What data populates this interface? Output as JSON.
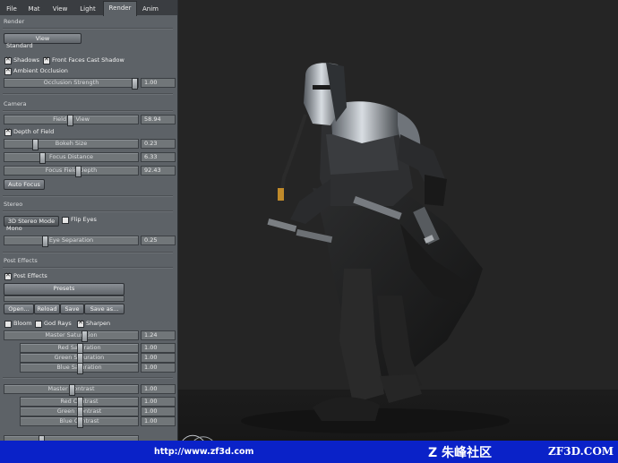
{
  "tabs": [
    "File",
    "Mat",
    "View",
    "Light",
    "Render",
    "Anim"
  ],
  "render": {
    "section": "Render",
    "view_button": "View",
    "view_value": "Standard",
    "shadows": {
      "label": "Shadows",
      "checked": true
    },
    "front_faces": {
      "label": "Front Faces Cast Shadow",
      "checked": true
    },
    "ambient_occlusion": {
      "label": "Ambient Occlusion",
      "checked": true
    },
    "occlusion_strength": {
      "label": "Occlusion Strength",
      "value": "1.00",
      "level": 0.97
    }
  },
  "camera": {
    "section": "Camera",
    "field_of_view": {
      "label": "Field of View",
      "value": "58.94",
      "level": 0.49
    },
    "depth_of_field": {
      "label": "Depth of Field",
      "checked": true
    },
    "bokeh_size": {
      "label": "Bokeh Size",
      "value": "0.23",
      "level": 0.23
    },
    "focus_distance": {
      "label": "Focus Distance",
      "value": "6.33",
      "level": 0.28
    },
    "focus_field_depth": {
      "label": "Focus Field Depth",
      "value": "92.43",
      "level": 0.55
    },
    "auto_focus": "Auto Focus"
  },
  "stereo": {
    "section": "Stereo",
    "mode_button": "3D Stereo Mode",
    "mode_value": "Mono",
    "flip_eyes": {
      "label": "Flip Eyes",
      "checked": false
    },
    "eye_separation": {
      "label": "Eye Separation",
      "value": "0.25",
      "level": 0.3
    }
  },
  "post": {
    "section": "Post Effects",
    "post_effects": {
      "label": "Post Effects",
      "checked": true
    },
    "presets": "Presets",
    "open": "Open...",
    "reload": "Reload",
    "save": "Save",
    "save_as": "Save as...",
    "bloom": {
      "label": "Bloom",
      "checked": false
    },
    "god_rays": {
      "label": "God Rays",
      "checked": false
    },
    "sharpen": {
      "label": "Sharpen",
      "checked": true
    },
    "master_saturation": {
      "label": "Master Saturation",
      "value": "1.24",
      "level": 0.6
    },
    "red_saturation": {
      "label": "Red Saturation",
      "value": "1.00",
      "level": 0.5
    },
    "green_saturation": {
      "label": "Green Saturation",
      "value": "1.00",
      "level": 0.5
    },
    "blue_saturation": {
      "label": "Blue Saturation",
      "value": "1.00",
      "level": 0.5
    },
    "master_contrast": {
      "label": "Master Contrast",
      "value": "1.00",
      "level": 0.5
    },
    "red_contrast": {
      "label": "Red Contrast",
      "value": "1.00",
      "level": 0.5
    },
    "green_contrast": {
      "label": "Green Contrast",
      "value": "1.00",
      "level": 0.5
    },
    "blue_contrast": {
      "label": "Blue Contrast",
      "value": "1.00",
      "level": 0.5
    }
  },
  "watermark": {
    "url": "http://www.zf3d.com",
    "brand": "Z 朱峰社区",
    "site": "ZF3D.COM"
  },
  "colors": {
    "panel": "#5d6267",
    "viewport": "#252525",
    "watermark_bar": "#0a22c8"
  }
}
